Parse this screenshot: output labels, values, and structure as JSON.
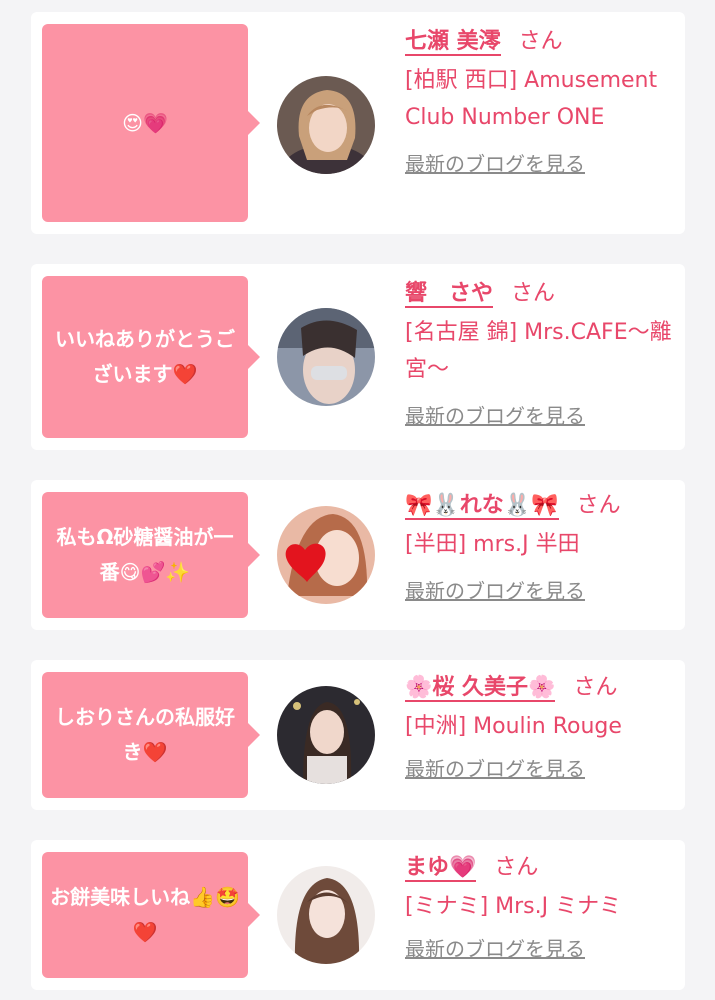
{
  "cards": [
    {
      "bubble_text": "😍💗",
      "name": "七瀬 美澪",
      "honorific": "さん",
      "shop": "[柏駅 西口] Amusement Club Number ONE",
      "blog_link": "最新のブログを見る"
    },
    {
      "bubble_text": "いいねありがとうございます❤️",
      "name": "響　さや",
      "honorific": "さん",
      "shop": "[名古屋 錦] Mrs.CAFE〜離宮〜",
      "blog_link": "最新のブログを見る"
    },
    {
      "bubble_text": "私もΩ砂糖醤油が一番😋💕✨",
      "name": "🎀🐰れな🐰🎀",
      "honorific": "さん",
      "shop": "[半田] mrs.J 半田",
      "blog_link": "最新のブログを見る"
    },
    {
      "bubble_text": "しおりさんの私服好き❤️",
      "name": "🌸桜 久美子🌸",
      "honorific": "さん",
      "shop": "[中洲] Moulin Rouge",
      "blog_link": "最新のブログを見る"
    },
    {
      "bubble_text": "お餅美味しいね👍🤩❤️",
      "name": "まゆ💗",
      "honorific": "さん",
      "shop": "[ミナミ] Mrs.J ミナミ",
      "blog_link": "最新のブログを見る"
    }
  ],
  "colors": {
    "accent": "#e8476a",
    "bubble": "#fc93a4",
    "background": "#f4f4f6",
    "link_gray": "#8a8a8a"
  }
}
